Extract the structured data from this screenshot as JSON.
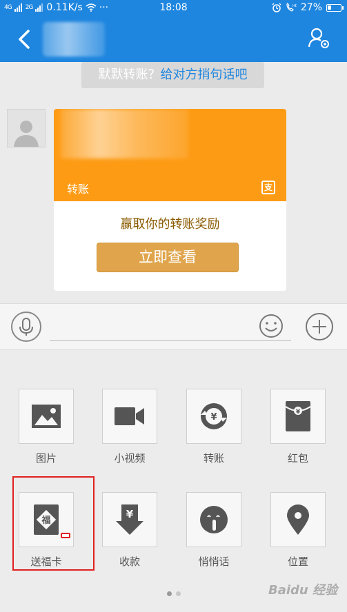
{
  "status_bar": {
    "signal_1": "4G",
    "signal_2": "2G",
    "speed": "0.11K/s",
    "time": "18:08",
    "battery": "27%",
    "battery_level": 0.27
  },
  "chat": {
    "tip_text": "默默转账？",
    "tip_link": "给对方捎句话吧"
  },
  "card": {
    "label": "转账",
    "badge": "支",
    "headline": "赢取你的转账奖励",
    "button": "立即查看"
  },
  "input": {
    "placeholder": ""
  },
  "panel": {
    "items": [
      {
        "label": "图片",
        "icon": "image-icon"
      },
      {
        "label": "小视频",
        "icon": "video-icon"
      },
      {
        "label": "转账",
        "icon": "transfer-icon"
      },
      {
        "label": "红包",
        "icon": "red-packet-icon"
      },
      {
        "label": "送福卡",
        "icon": "fu-card-icon"
      },
      {
        "label": "收款",
        "icon": "receive-money-icon"
      },
      {
        "label": "悄悄话",
        "icon": "whisper-icon"
      },
      {
        "label": "位置",
        "icon": "location-icon"
      }
    ],
    "page_count": 2,
    "current_page": 1
  },
  "watermark": "Baidu 经验",
  "colors": {
    "brand_blue": "#1f86df",
    "card_orange": "#fd9b14",
    "button_gold": "#e0a54c",
    "highlight_red": "#e02020"
  }
}
